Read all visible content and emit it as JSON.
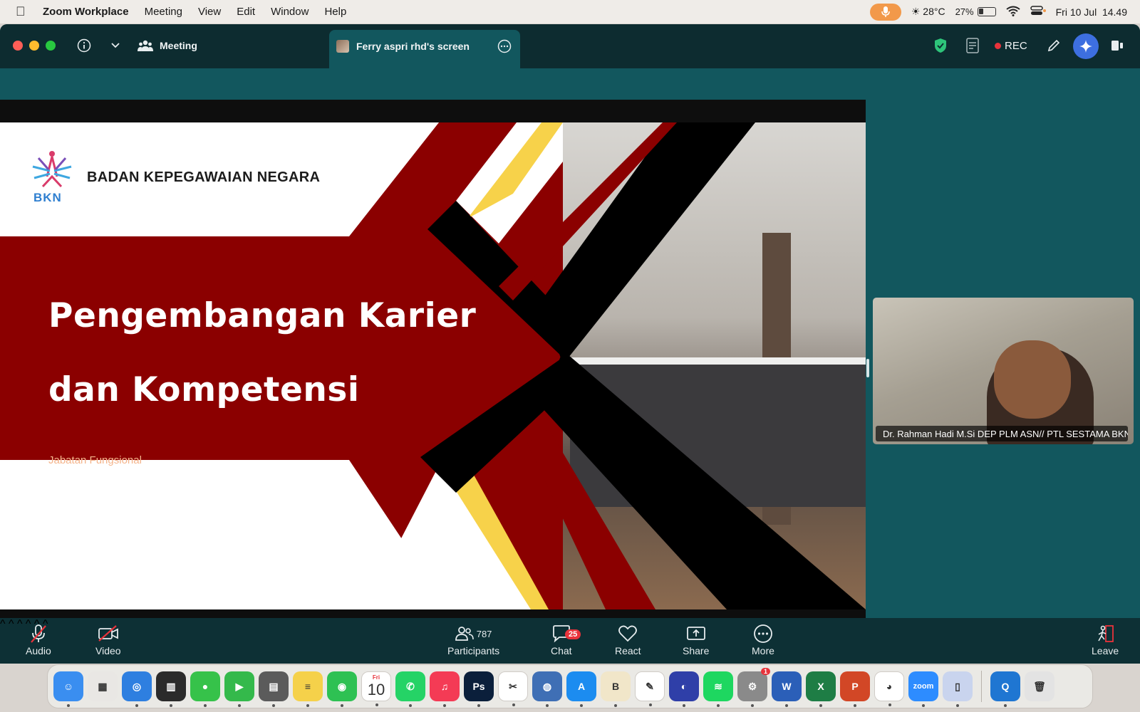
{
  "menubar": {
    "app_name": "Zoom Workplace",
    "items": [
      "Meeting",
      "View",
      "Edit",
      "Window",
      "Help"
    ],
    "weather": "28°C",
    "battery_percent": "27%",
    "datetime": "Fri 10 Jul  14.49"
  },
  "titlebar": {
    "meeting_label": "Meeting",
    "share_tab_label": "Ferry aspri rhd's screen",
    "rec_label": "REC"
  },
  "slide": {
    "org_name": "BADAN KEPEGAWAIAN NEGARA",
    "logo_text": "BKN",
    "title_line1": "Pengembangan Karier",
    "title_line2": "dan Kompetensi",
    "subtitle": "Jabatan Fungsional"
  },
  "participant_video": {
    "name": "Dr. Rahman Hadi M.Si DEP PLM ASN// PTL SESTAMA BKN"
  },
  "toolbar": {
    "audio_label": "Audio",
    "video_label": "Video",
    "participants_label": "Participants",
    "participants_count": "787",
    "chat_label": "Chat",
    "chat_badge": "25",
    "react_label": "React",
    "share_label": "Share",
    "more_label": "More",
    "leave_label": "Leave"
  },
  "dock": {
    "calendar_month": "Fri",
    "calendar_day": "10",
    "settings_badge": "1",
    "zoom_label": "zoom",
    "apps": [
      {
        "name": "finder-icon",
        "color": "#3a8ef0",
        "glyph": "☺"
      },
      {
        "name": "launchpad-icon",
        "color": "#e9e7e4",
        "glyph": "▦"
      },
      {
        "name": "safari-icon",
        "color": "#2e7fe0",
        "glyph": "◎"
      },
      {
        "name": "photos-gallery-icon",
        "color": "#2b2b2b",
        "glyph": "▥"
      },
      {
        "name": "messages-icon",
        "color": "#36c24a",
        "glyph": "●"
      },
      {
        "name": "facetime-icon",
        "color": "#34b94b",
        "glyph": "▶"
      },
      {
        "name": "calculator-icon",
        "color": "#5b5b5b",
        "glyph": "▤"
      },
      {
        "name": "notes-icon",
        "color": "#f5d14a",
        "glyph": "≡"
      },
      {
        "name": "find-my-icon",
        "color": "#2ec153",
        "glyph": "◉"
      },
      {
        "name": "calendar-icon",
        "color": "#ffffff",
        "glyph": ""
      },
      {
        "name": "whatsapp-icon",
        "color": "#25d366",
        "glyph": "✆"
      },
      {
        "name": "music-icon",
        "color": "#f43b55",
        "glyph": "♫"
      },
      {
        "name": "photoshop-icon",
        "color": "#0b1f3b",
        "glyph": "Ps"
      },
      {
        "name": "capcut-icon",
        "color": "#ffffff",
        "glyph": "✂"
      },
      {
        "name": "keychain-icon",
        "color": "#3f6fb5",
        "glyph": "◍"
      },
      {
        "name": "app-store-icon",
        "color": "#1c8cf0",
        "glyph": "A"
      },
      {
        "name": "books-text-icon",
        "color": "#f1e6c9",
        "glyph": "B"
      },
      {
        "name": "reader-icon",
        "color": "#ffffff",
        "glyph": "✎"
      },
      {
        "name": "voice-app-icon",
        "color": "#2f3fa8",
        "glyph": "◐"
      },
      {
        "name": "spotify-icon",
        "color": "#1ed760",
        "glyph": "≋"
      },
      {
        "name": "system-settings-icon",
        "color": "#8a8a8a",
        "glyph": "⚙"
      },
      {
        "name": "word-icon",
        "color": "#2b5fb8",
        "glyph": "W"
      },
      {
        "name": "excel-icon",
        "color": "#1e7d45",
        "glyph": "X"
      },
      {
        "name": "powerpoint-icon",
        "color": "#d24726",
        "glyph": "P"
      },
      {
        "name": "chrome-icon",
        "color": "#ffffff",
        "glyph": "◕"
      },
      {
        "name": "zoom-app-icon",
        "color": "#2d8cff",
        "glyph": ""
      },
      {
        "name": "simulator-icon",
        "color": "#c9d4ee",
        "glyph": "▯"
      },
      {
        "name": "quicktime-icon",
        "color": "#1f76d2",
        "glyph": "Q"
      },
      {
        "name": "trash-icon",
        "color": "#e3e3e3",
        "glyph": "🗑"
      }
    ]
  }
}
